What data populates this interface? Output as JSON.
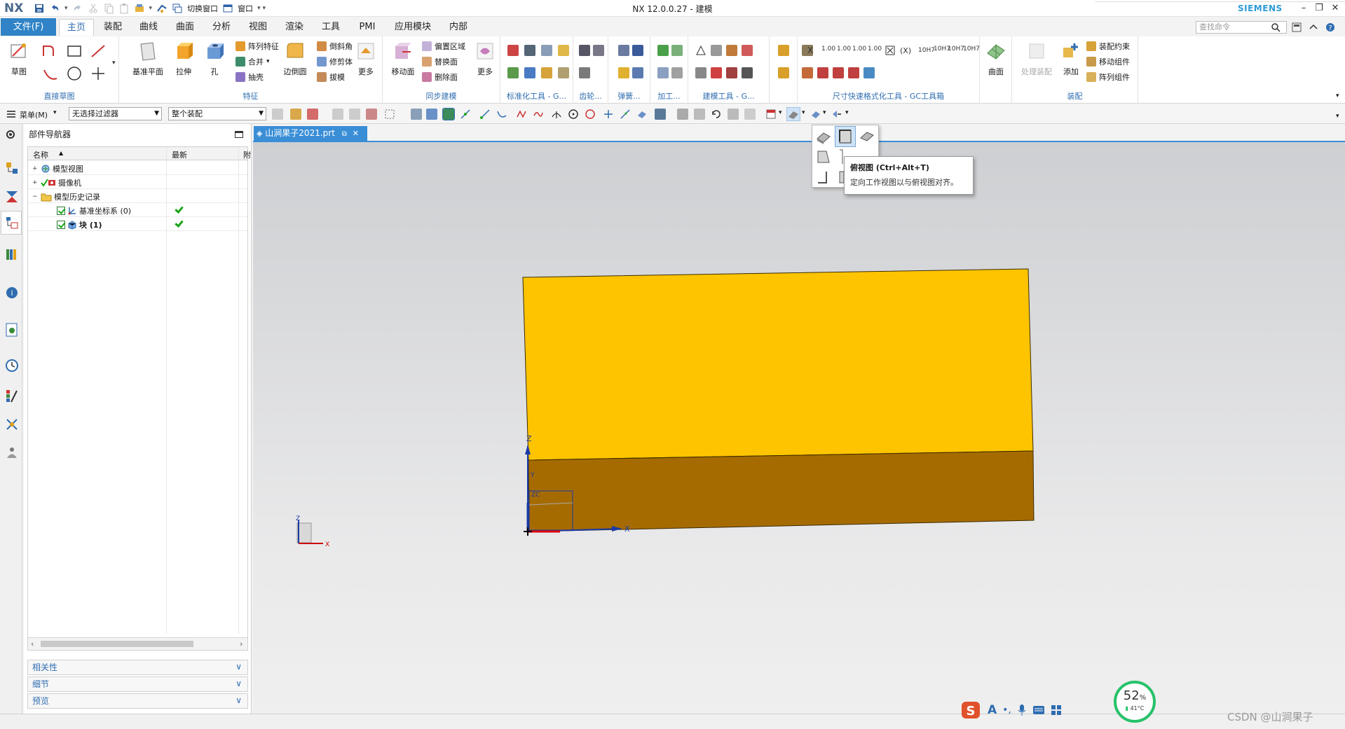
{
  "titlebar": {
    "logo": "NX",
    "switch_window": "切换窗口",
    "window_menu": "窗口",
    "title": "NX 12.0.0.27 - 建模",
    "brand": "SIEMENS"
  },
  "tabs": {
    "file": "文件(F)",
    "items": [
      "主页",
      "装配",
      "曲线",
      "曲面",
      "分析",
      "视图",
      "渲染",
      "工具",
      "PMI",
      "应用模块",
      "内部"
    ],
    "active": "主页",
    "search_placeholder": "查找命令"
  },
  "ribbon": {
    "sketch": "草图",
    "direct_sketch": "直接草图",
    "datum_plane": "基准平面",
    "extrude": "拉伸",
    "hole": "孔",
    "pattern_feature": "阵列特征",
    "unite": "合并",
    "shell": "抽壳",
    "edge_blend": "边倒圆",
    "chamfer": "倒斜角",
    "trim_body": "修剪体",
    "draft": "拔模",
    "more": "更多",
    "feature": "特征",
    "move_face": "移动面",
    "offset_region": "偏置区域",
    "replace_face": "替换面",
    "delete_face": "删除面",
    "sync_modeling": "同步建模",
    "standard_tools": "标准化工具 - G...",
    "gear": "齿轮...",
    "spring": "弹簧...",
    "machining": "加工...",
    "modeling_tools": "建模工具 - G...",
    "dimension_tools": "尺寸快速格式化工具 - GC工具箱",
    "surface": "曲面",
    "process_assembly": "处理装配",
    "add": "添加",
    "assembly_constraint": "装配约束",
    "move_component": "移动组件",
    "pattern_component": "阵列组件",
    "assembly": "装配",
    "dim_labels": [
      "1.00",
      "1.00",
      "1.00",
      "1.00",
      "10H7",
      "10H7",
      "10H7",
      "10H7",
      "10"
    ]
  },
  "selection_bar": {
    "menu": "菜单(M)",
    "filter": "无选择过滤器",
    "scope": "整个装配"
  },
  "navigator": {
    "title": "部件导航器",
    "columns": [
      "名称",
      "最新",
      "附"
    ],
    "rows": [
      {
        "label": "模型视图",
        "expander": "+"
      },
      {
        "label": "摄像机",
        "expander": "+"
      },
      {
        "label": "模型历史记录",
        "expander": "−"
      },
      {
        "label": "基准坐标系 (0)",
        "latest": true
      },
      {
        "label": "块 (1)",
        "latest": true
      }
    ],
    "panels": [
      "相关性",
      "细节",
      "预览"
    ]
  },
  "document": {
    "tab": "山涧果子2021.prt"
  },
  "viewport": {
    "top_face_color": "#ffc400",
    "front_face_color": "#a66b00",
    "background_top": "#cdcfd2",
    "background_bottom": "#efefef",
    "axis_labels": {
      "x": "X",
      "y": "Y",
      "z": "Z",
      "zc": "ZC",
      "xc": "XC",
      "yc": "YC"
    }
  },
  "tooltip": {
    "title": "俯视图 (Ctrl+Alt+T)",
    "description": "定向工作视图以与俯视图对齐。"
  },
  "status": {
    "cpu_percent": "52",
    "percent_sign": "%",
    "temperature": "41°C",
    "ime_label": "A",
    "watermark": "CSDN @山涧果子"
  }
}
